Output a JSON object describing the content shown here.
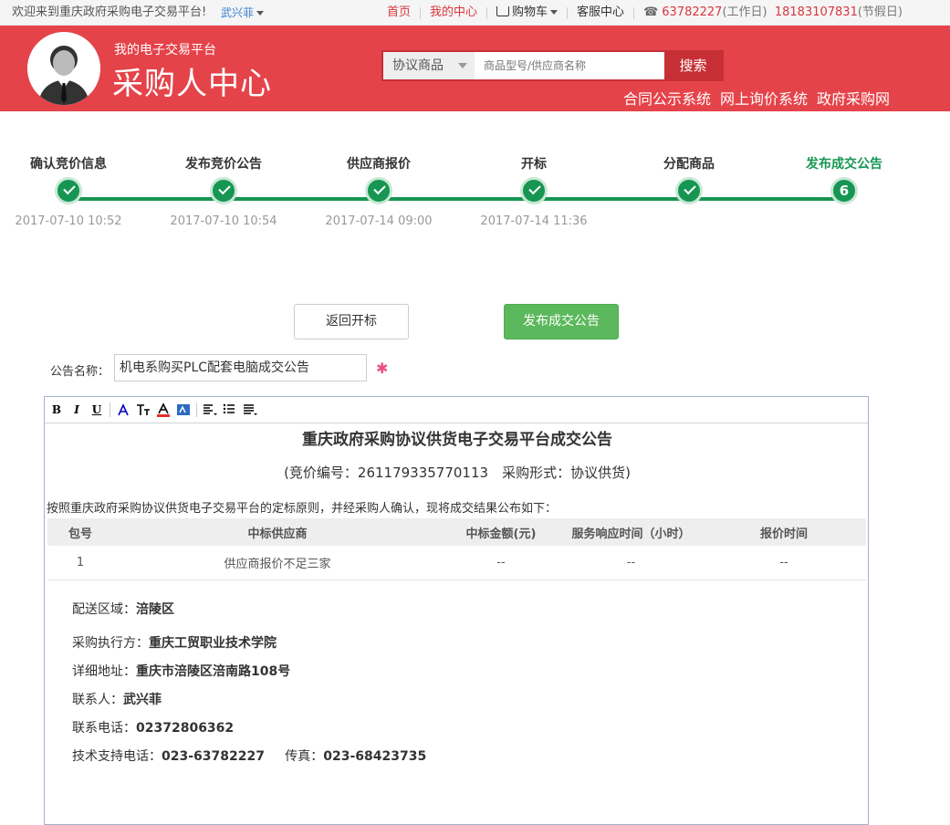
{
  "topbar": {
    "welcome": "欢迎来到重庆政府采购电子交易平台!",
    "user": "武兴菲",
    "nav": {
      "home": "首页",
      "my_center": "我的中心",
      "cart": "购物车",
      "service": "客服中心",
      "phone_work": "63782227",
      "phone_work_note": "(工作日)",
      "phone_holiday": "18183107831",
      "phone_holiday_note": "(节假日)"
    }
  },
  "header": {
    "subtitle": "我的电子交易平台",
    "title": "采购人中心",
    "search": {
      "category": "协议商品",
      "placeholder": "商品型号/供应商名称",
      "button": "搜索"
    },
    "links": [
      "合同公示系统",
      "网上询价系统",
      "政府采购网"
    ]
  },
  "steps": [
    {
      "label": "确认竞价信息",
      "time": "2017-07-10 10:52",
      "state": "done"
    },
    {
      "label": "发布竞价公告",
      "time": "2017-07-10 10:54",
      "state": "done"
    },
    {
      "label": "供应商报价",
      "time": "2017-07-14 09:00",
      "state": "done"
    },
    {
      "label": "开标",
      "time": "2017-07-14 11:36",
      "state": "done"
    },
    {
      "label": "分配商品",
      "time": "",
      "state": "done"
    },
    {
      "label": "发布成交公告",
      "time": "",
      "state": "current",
      "number": "6"
    }
  ],
  "actions": {
    "back": "返回开标",
    "publish": "发布成交公告"
  },
  "form": {
    "name_label": "公告名称：",
    "name_value": "机电系购买PLC配套电脑成交公告",
    "required_mark": "✱"
  },
  "colors": {
    "brand_red": "#e5434a",
    "step_green": "#179653",
    "publish_green": "#5cb85c"
  },
  "document": {
    "title": "重庆政府采购协议供货电子交易平台成交公告",
    "subtitle": "(竞价编号：261179335770113　采购形式：协议供货)",
    "intro": "按照重庆政府采购协议供货电子交易平台的定标原则，并经采购人确认，现将成交结果公布如下：",
    "table": {
      "headers": [
        "包号",
        "中标供应商",
        "中标金额(元)",
        "服务响应时间（小时）",
        "报价时间"
      ],
      "rows": [
        [
          "1",
          "供应商报价不足三家",
          "--",
          "--",
          "--"
        ]
      ]
    },
    "delivery_label": "配送区域：",
    "delivery_value": "涪陵区",
    "executor_label": "采购执行方：",
    "executor_value": "重庆工贸职业技术学院",
    "address_label": "详细地址：",
    "address_value": "重庆市涪陵区涪南路108号",
    "contact_label": "联系人：",
    "contact_value": "武兴菲",
    "tel_label": "联系电话：",
    "tel_value": "02372806362",
    "support_label": "技术支持电话：",
    "support_value": "023-63782227",
    "fax_label": "传真：",
    "fax_value": "023-68423735"
  }
}
